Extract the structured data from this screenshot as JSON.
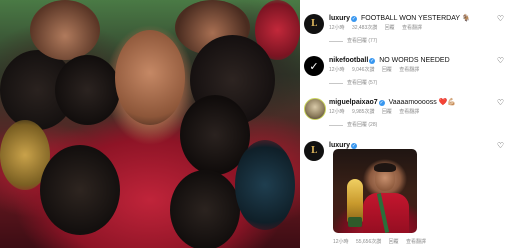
{
  "comments": [
    {
      "user": "luxury",
      "avatar_text": "L",
      "text": "FOOTBALL WON YESTERDAY 🐐",
      "time": "12小時",
      "likes": "32,483次讚",
      "reply": "回覆",
      "translate": "查看翻譯",
      "view_replies": "查看回覆 (77)"
    },
    {
      "user": "nikefootball",
      "avatar_text": "✓",
      "text": "NO WORDS NEEDED",
      "time": "12小時",
      "likes": "9,046次讚",
      "reply": "回覆",
      "translate": "查看翻譯",
      "view_replies": "查看回覆 (57)"
    },
    {
      "user": "miguelpaixao7",
      "avatar_text": "",
      "text": "Vaaaamooooss ❤️💪🏼",
      "time": "12小時",
      "likes": "9,985次讚",
      "reply": "回覆",
      "translate": "查看翻譯",
      "view_replies": "查看回覆 (28)"
    },
    {
      "user": "luxury",
      "avatar_text": "L",
      "text": "",
      "time": "12小時",
      "likes": "55,656次讚",
      "reply": "回覆",
      "translate": "查看翻譯",
      "view_replies": ""
    }
  ],
  "verified_mark": "✓",
  "heart_icon": "♡",
  "colors": {
    "verified": "#3897f0",
    "meta": "#8e8e8e",
    "text": "#111111"
  }
}
